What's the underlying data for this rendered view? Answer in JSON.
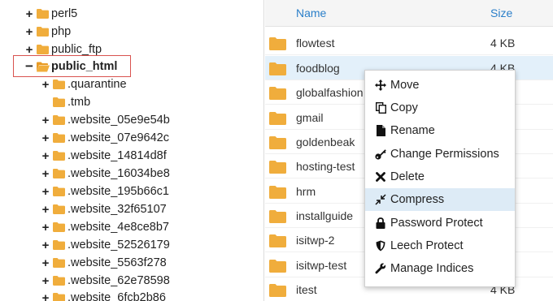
{
  "tree": {
    "items": [
      {
        "label": "perl5",
        "expander": "+"
      },
      {
        "label": "php",
        "expander": "+"
      },
      {
        "label": "public_ftp",
        "expander": "+"
      },
      {
        "label": "public_html",
        "expander": "−"
      },
      {
        "label": ".quarantine",
        "expander": "+"
      },
      {
        "label": ".tmb",
        "expander": ""
      },
      {
        "label": ".website_05e9e54b",
        "expander": "+"
      },
      {
        "label": ".website_07e9642c",
        "expander": "+"
      },
      {
        "label": ".website_14814d8f",
        "expander": "+"
      },
      {
        "label": ".website_16034be8",
        "expander": "+"
      },
      {
        "label": ".website_195b66c1",
        "expander": "+"
      },
      {
        "label": ".website_32f65107",
        "expander": "+"
      },
      {
        "label": ".website_4e8ce8b7",
        "expander": "+"
      },
      {
        "label": ".website_52526179",
        "expander": "+"
      },
      {
        "label": ".website_5563f278",
        "expander": "+"
      },
      {
        "label": ".website_62e78598",
        "expander": "+"
      },
      {
        "label": ".website_6fcb2b86",
        "expander": "+"
      }
    ]
  },
  "files": {
    "header": {
      "name": "Name",
      "size": "Size"
    },
    "rows": [
      {
        "name": "flowtest",
        "size": "4 KB"
      },
      {
        "name": "foodblog",
        "size": "4 KB"
      },
      {
        "name": "globalfashion",
        "size": ""
      },
      {
        "name": "gmail",
        "size": ""
      },
      {
        "name": "goldenbeak",
        "size": ""
      },
      {
        "name": "hosting-test",
        "size": ""
      },
      {
        "name": "hrm",
        "size": ""
      },
      {
        "name": "installguide",
        "size": ""
      },
      {
        "name": "isitwp-2",
        "size": ""
      },
      {
        "name": "isitwp-test",
        "size": ""
      },
      {
        "name": "itest",
        "size": "4 KB"
      }
    ]
  },
  "context_menu": {
    "items": [
      {
        "label": "Move",
        "icon": "move-icon"
      },
      {
        "label": "Copy",
        "icon": "copy-icon"
      },
      {
        "label": "Rename",
        "icon": "file-icon"
      },
      {
        "label": "Change Permissions",
        "icon": "key-icon"
      },
      {
        "label": "Delete",
        "icon": "close-icon"
      },
      {
        "label": "Compress",
        "icon": "compress-icon"
      },
      {
        "label": "Password Protect",
        "icon": "lock-icon"
      },
      {
        "label": "Leech Protect",
        "icon": "shield-icon"
      },
      {
        "label": "Manage Indices",
        "icon": "wrench-icon"
      }
    ]
  },
  "colors": {
    "folder": "#f0ad3c",
    "link": "#2a7fc9",
    "selected_row": "#e3f0fa",
    "menu_hover": "#ddebf6",
    "highlight_box": "#d9534f"
  }
}
